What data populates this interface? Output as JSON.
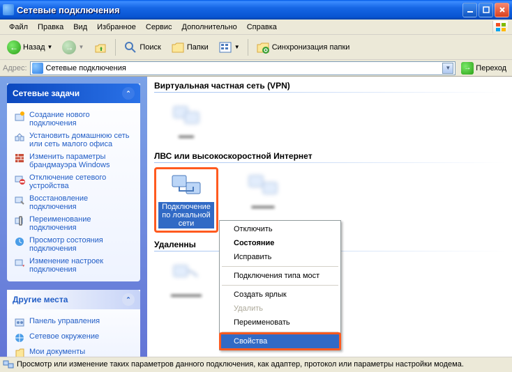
{
  "window": {
    "title": "Сетевые подключения"
  },
  "menu": {
    "file": "Файл",
    "edit": "Правка",
    "view": "Вид",
    "favorites": "Избранное",
    "tools": "Сервис",
    "advanced": "Дополнительно",
    "help": "Справка"
  },
  "toolbar": {
    "back": "Назад",
    "search": "Поиск",
    "folders": "Папки",
    "sync": "Синхронизация папки"
  },
  "addressbar": {
    "label": "Адрес:",
    "value": "Сетевые подключения",
    "go": "Переход"
  },
  "sidebar": {
    "tasks": {
      "title": "Сетевые задачи",
      "items": [
        "Создание нового подключения",
        "Установить домашнюю сеть или сеть малого офиса",
        "Изменить параметры брандмауэра Windows",
        "Отключение сетевого устройства",
        "Восстановление подключения",
        "Переименование подключения",
        "Просмотр состояния подключения",
        "Изменение настроек подключения"
      ]
    },
    "places": {
      "title": "Другие места",
      "items": [
        "Панель управления",
        "Сетевое окружение",
        "Мои документы"
      ]
    }
  },
  "content": {
    "section_vpn": "Виртуальная частная сеть (VPN)",
    "section_lan": "ЛВС или высокоскоростной Интернет",
    "section_remote": "Удаленны",
    "lan_connection": "Подключение по локальной сети"
  },
  "context_menu": {
    "disable": "Отключить",
    "status": "Состояние",
    "repair": "Исправить",
    "bridge": "Подключения типа мост",
    "shortcut": "Создать ярлык",
    "delete": "Удалить",
    "rename": "Переименовать",
    "properties": "Свойства"
  },
  "statusbar": {
    "text": "Просмотр или изменение таких параметров данного подключения, как адаптер, протокол или параметры настройки модема."
  }
}
